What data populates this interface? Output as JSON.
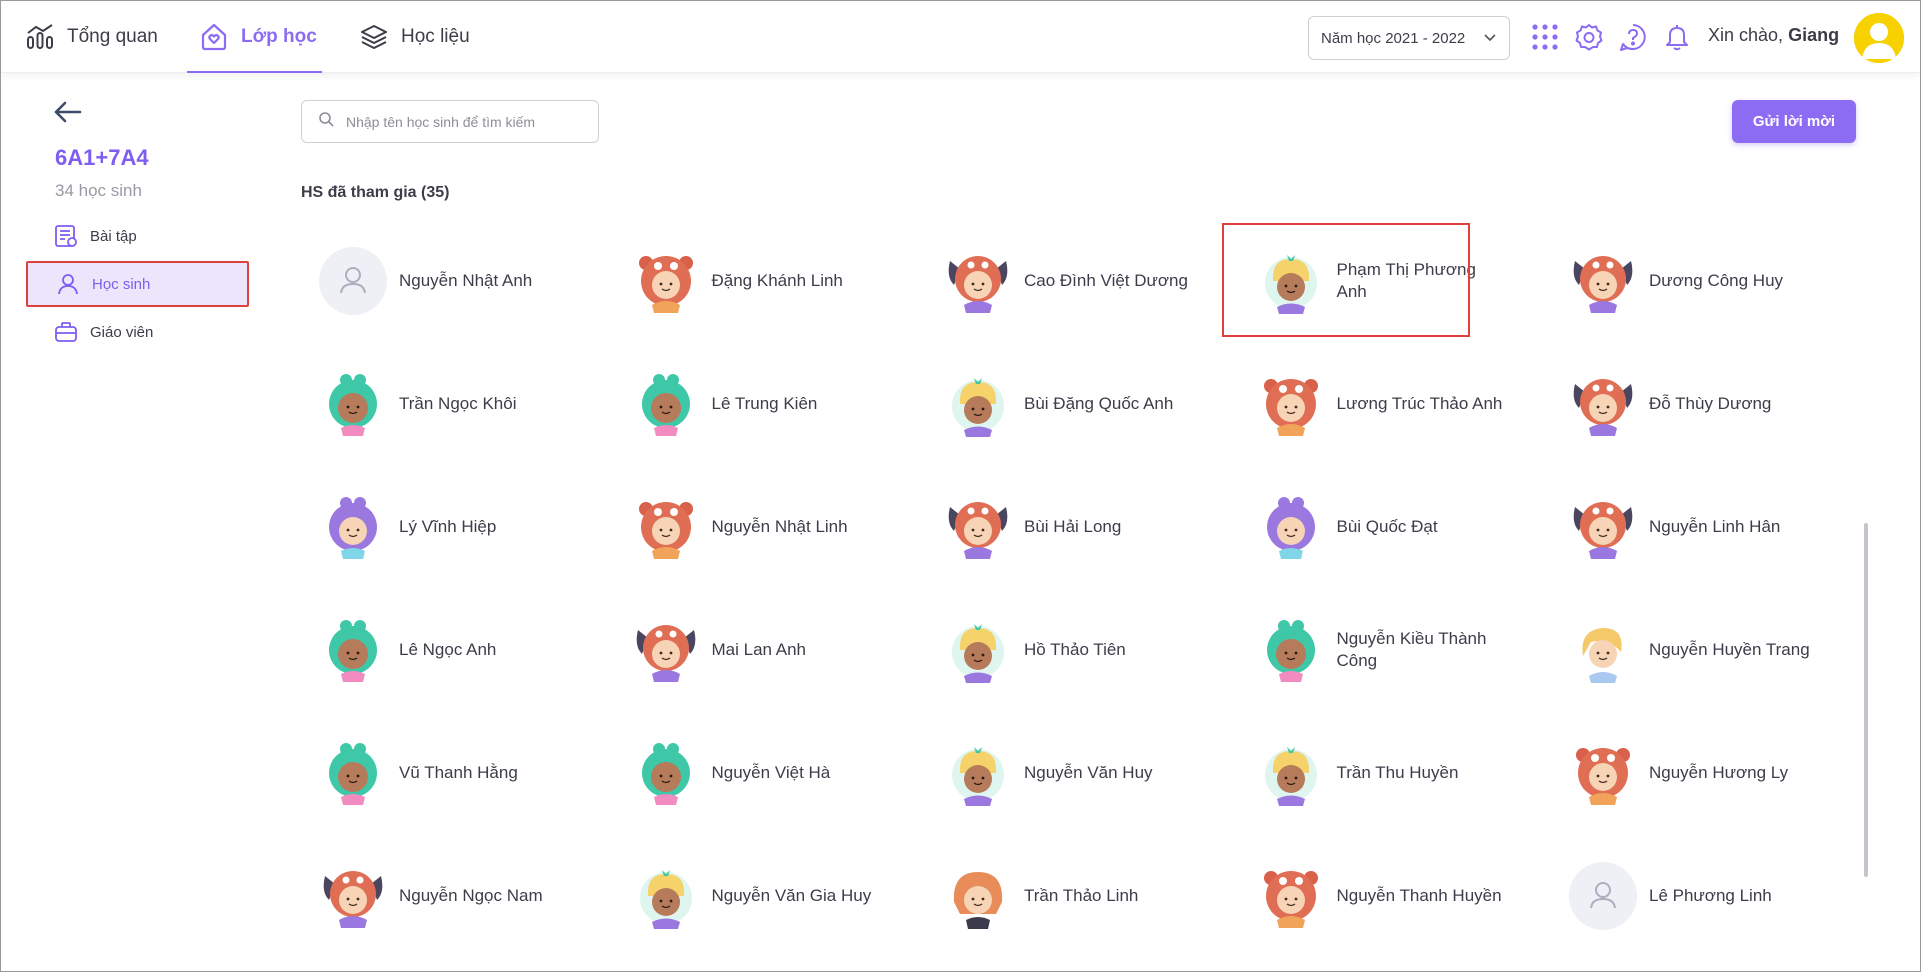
{
  "topbar": {
    "nav": [
      {
        "label": "Tổng quan",
        "icon": "chart-icon"
      },
      {
        "label": "Lớp học",
        "icon": "class-heart-icon"
      },
      {
        "label": "Học liệu",
        "icon": "layers-icon"
      }
    ],
    "year_select": "Năm học 2021 - 2022",
    "greeting_prefix": "Xin chào,",
    "greeting_name": "Giang"
  },
  "sidebar": {
    "class_name": "6A1+7A4",
    "class_count": "34 học sinh",
    "items": [
      {
        "label": "Bài tập",
        "icon": "assignment-icon"
      },
      {
        "label": "Học sinh",
        "icon": "student-icon",
        "active": true
      },
      {
        "label": "Giáo viên",
        "icon": "teacher-icon"
      }
    ]
  },
  "main": {
    "search_placeholder": "Nhập tên học sinh để tìm kiếm",
    "invite_button": "Gửi lời mời",
    "section_title": "HS đã tham gia (35)",
    "students": [
      {
        "name": "Nguyễn Nhật Anh",
        "avatar": "default"
      },
      {
        "name": "Đặng Khánh Linh",
        "avatar": "red"
      },
      {
        "name": "Cao Đình Việt Dương",
        "avatar": "dog"
      },
      {
        "name": "Phạm Thị Phương Anh",
        "avatar": "yellow",
        "highlighted": true
      },
      {
        "name": "Dương Công Huy",
        "avatar": "dog"
      },
      {
        "name": "Trần Ngọc Khôi",
        "avatar": "green"
      },
      {
        "name": "Lê Trung Kiên",
        "avatar": "green"
      },
      {
        "name": "Bùi Đặng Quốc Anh",
        "avatar": "yellow"
      },
      {
        "name": "Lương Trúc Thảo Anh",
        "avatar": "red"
      },
      {
        "name": "Đỗ Thùy Dương",
        "avatar": "dog"
      },
      {
        "name": "Lý Vĩnh Hiệp",
        "avatar": "purple"
      },
      {
        "name": "Nguyễn Nhật Linh",
        "avatar": "red"
      },
      {
        "name": "Bùi Hải Long",
        "avatar": "dog"
      },
      {
        "name": "Bùi Quốc Đạt",
        "avatar": "purple"
      },
      {
        "name": "Nguyễn Linh Hân",
        "avatar": "dog"
      },
      {
        "name": "Lê Ngọc Anh",
        "avatar": "green"
      },
      {
        "name": "Mai Lan Anh",
        "avatar": "dog"
      },
      {
        "name": "Hồ Thảo Tiên",
        "avatar": "yellow"
      },
      {
        "name": "Nguyễn Kiều Thành Công",
        "avatar": "green"
      },
      {
        "name": "Nguyễn Huyền Trang",
        "avatar": "blonde"
      },
      {
        "name": "Vũ Thanh Hằng",
        "avatar": "green"
      },
      {
        "name": "Nguyễn Việt Hà",
        "avatar": "green"
      },
      {
        "name": "Nguyễn Văn Huy",
        "avatar": "yellow"
      },
      {
        "name": "Trần Thu Huyền",
        "avatar": "yellow"
      },
      {
        "name": "Nguyễn Hương Ly",
        "avatar": "red"
      },
      {
        "name": "Nguyễn Ngọc Nam",
        "avatar": "dog"
      },
      {
        "name": "Nguyễn Văn Gia Huy",
        "avatar": "yellow"
      },
      {
        "name": "Trần Thảo Linh",
        "avatar": "girl"
      },
      {
        "name": "Nguyễn Thanh Huyền",
        "avatar": "red"
      },
      {
        "name": "Lê Phương Linh",
        "avatar": "default"
      }
    ]
  },
  "colors": {
    "accent": "#8b6cf2",
    "highlight_border": "#e0403b",
    "active_bg": "#ebe6fc"
  }
}
